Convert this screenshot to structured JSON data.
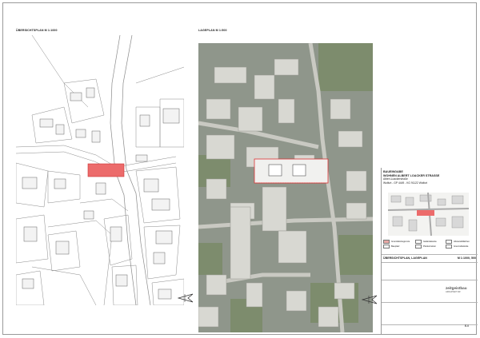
{
  "overview": {
    "title": "ÜBERSICHTSPLAN M 1:1000"
  },
  "site": {
    "title": "LAGEPLAN M 1:500"
  },
  "titleblock": {
    "project_title": "BAUEINGABE",
    "project_subtitle": "WOHNEN ALBERT LOACKER STRASSE",
    "address": "Albert-Loackerstraße",
    "parcel": "Wolfurt - GP 4449 - KG 91122 Wolfurt",
    "legend": [
      {
        "label": "Grundstücksgrenze",
        "color": "#e8a9a6"
      },
      {
        "label": "Bauplatz",
        "color": "#f7f7f7"
      },
      {
        "label": "Geländekante",
        "color": "#ffffff"
      },
      {
        "label": "Plankorrektur",
        "color": "#ffffff"
      },
      {
        "label": "Abstandsflächen",
        "color": "#ffffff"
      },
      {
        "label": "Grenzabstände",
        "color": "#ffffff"
      }
    ],
    "plan_title": "ÜBERSICHTSPLAN, LAGEPLAN",
    "plan_scale": "M 1:1000, 500",
    "plan_number": "E-0",
    "logo_text": "zeitgeistbau",
    "logo_sub": "ARCHITEKTUR"
  }
}
